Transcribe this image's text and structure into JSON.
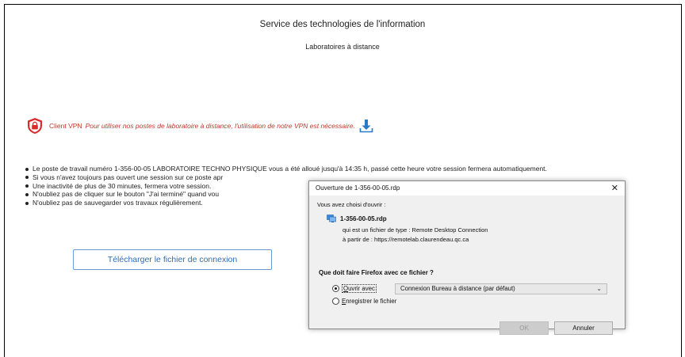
{
  "header": {
    "title": "Service des technologies de l'information",
    "subtitle": "Laboratoires à distance"
  },
  "vpn": {
    "label": "Client VPN",
    "message": "Pour utiliser nos postes de laboratoire à distance, l'utilisation de notre VPN est nécessaire.",
    "icon": "shield-lock-icon",
    "download_icon": "download-icon",
    "accent": "#c0392b"
  },
  "bullets": [
    "Le poste de travail numéro 1-356-00-05 LABORATOIRE TECHNO PHYSIQUE vous a été alloué jusqu'à 14:35 h, passé cette heure votre session fermera automatiquement.",
    "Si vous n'avez toujours pas ouvert une session sur ce poste apr",
    "Une inactivité de plus de 30 minutes, fermera votre session.",
    "N'oubliez pas de cliquer sur le bouton \"J'ai terminé\" quand vou",
    "N'oubliez pas de sauvegarder vos travaux régulièrement."
  ],
  "download_button": {
    "label": "Télécharger le fichier de connexion"
  },
  "dialog": {
    "title": "Ouverture de 1-356-00-05.rdp",
    "close": "✕",
    "chosen_text": "Vous avez choisi d'ouvrir :",
    "filename": "1-356-00-05.rdp",
    "type_text": "qui est un fichier de type : Remote Desktop Connection",
    "from_text": "à partir de : https://remotelab.claurendeau.qc.ca",
    "question": "Que doit faire Firefox avec ce fichier ?",
    "open_with_underlined": "O",
    "open_with_rest": "uvrir avec",
    "open_with_app": "Connexion Bureau à distance (par défaut)",
    "save_underlined": "E",
    "save_rest": "nregistrer le fichier",
    "ok": "OK",
    "cancel": "Annuler"
  }
}
